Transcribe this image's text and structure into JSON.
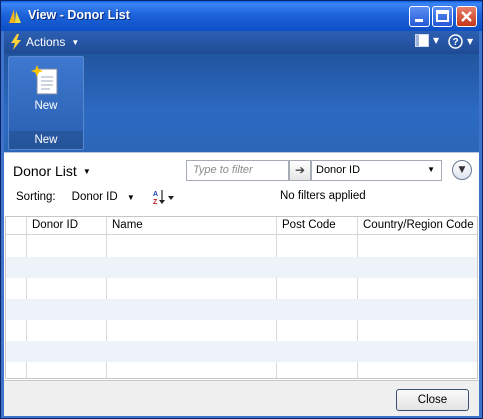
{
  "window": {
    "title": "View - Donor List"
  },
  "actions_bar": {
    "actions_label": "Actions"
  },
  "ribbon": {
    "new_button_label": "New",
    "group_label": "New"
  },
  "list": {
    "title": "Donor List",
    "filter_placeholder": "Type to filter",
    "filter_field": "Donor ID",
    "sorting_label": "Sorting:",
    "sorting_value": "Donor ID",
    "filter_status": "No filters applied"
  },
  "grid": {
    "columns": [
      "Donor ID",
      "Name",
      "Post Code",
      "Country/Region Code"
    ],
    "rows": []
  },
  "footer": {
    "close_label": "Close"
  },
  "colors": {
    "title_bar": "#1e63d9",
    "ribbon": "#2c6ac2",
    "row_alt": "#eef3fa"
  },
  "icons": [
    "nav-logo-icon",
    "minimize-icon",
    "maximize-icon",
    "close-icon",
    "lightning-icon",
    "layout-icon",
    "help-icon",
    "new-document-icon",
    "arrow-right-icon",
    "expand-icon",
    "sort-az-icon"
  ]
}
